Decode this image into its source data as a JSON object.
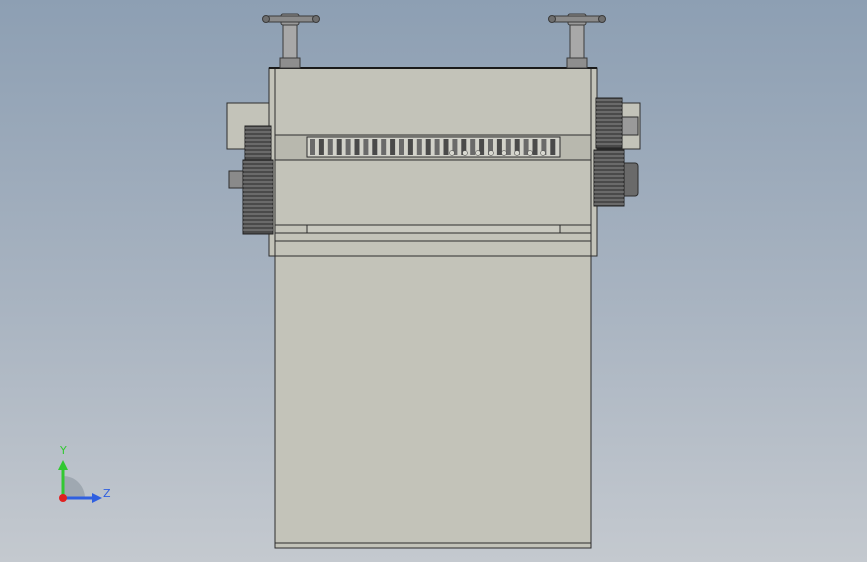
{
  "viewport": {
    "background_top": "#8d9fb3",
    "background_bottom": "#c4c9cf"
  },
  "model": {
    "body_color": "#c3c3b9",
    "edge_color": "#2d2d2d",
    "gear_color": "#3a3a3a",
    "shaft_color": "#8a8a8a"
  },
  "triad": {
    "y_label": "Y",
    "z_label": "Z",
    "y_color": "#32c832",
    "z_color": "#2f5fe0",
    "x_color": "#e02020"
  }
}
